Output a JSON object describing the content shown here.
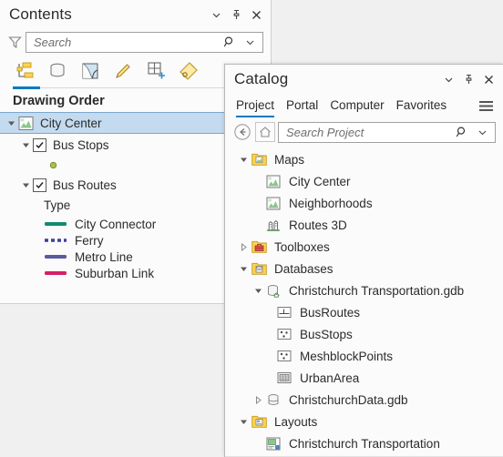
{
  "contents": {
    "title": "Contents",
    "titlebar_buttons": [
      {
        "name": "menu-chevron",
        "label": "⌄"
      },
      {
        "name": "pin",
        "label": "pin"
      },
      {
        "name": "close",
        "label": "×"
      }
    ],
    "filter_icon": "filter-icon",
    "search": {
      "placeholder": "Search",
      "value": ""
    },
    "toolbar": [
      {
        "name": "list-by-drawing-order",
        "label": "List By Drawing Order",
        "active": true
      },
      {
        "name": "list-by-data-source",
        "label": "List By Data Source",
        "active": false
      },
      {
        "name": "list-by-selection",
        "label": "List By Selection",
        "active": false
      },
      {
        "name": "list-by-editing",
        "label": "List By Editing",
        "active": false
      },
      {
        "name": "list-by-snapping",
        "label": "List By Snapping",
        "active": false
      },
      {
        "name": "list-by-labeling",
        "label": "List By Labeling",
        "active": false
      }
    ],
    "drawing_order_label": "Drawing Order",
    "tree": {
      "map": {
        "label": "City Center",
        "selected": true,
        "expanded": true
      },
      "layers": [
        {
          "label": "Bus Stops",
          "checked": true,
          "expanded": true,
          "symbol_type": "point",
          "point_color": "#8ea832",
          "legend": []
        },
        {
          "label": "Bus Routes",
          "checked": true,
          "expanded": true,
          "symbol_type": "line",
          "legend_heading": "Type",
          "legend": [
            {
              "label": "City Connector",
              "color": "#138a6a",
              "style": "solid"
            },
            {
              "label": "Ferry",
              "color": "#3c3f9e",
              "style": "dashed"
            },
            {
              "label": "Metro Line",
              "color": "#5a5a9e",
              "style": "solid"
            },
            {
              "label": "Suburban Link",
              "color": "#d61f69",
              "style": "solid"
            }
          ]
        }
      ]
    }
  },
  "catalog": {
    "title": "Catalog",
    "titlebar_buttons": [
      {
        "name": "menu-chevron",
        "label": "⌄"
      },
      {
        "name": "pin",
        "label": "pin"
      },
      {
        "name": "close",
        "label": "×"
      }
    ],
    "tabs": [
      {
        "label": "Project",
        "active": true
      },
      {
        "label": "Portal",
        "active": false
      },
      {
        "label": "Computer",
        "active": false
      },
      {
        "label": "Favorites",
        "active": false
      }
    ],
    "hamburger_label": "menu-icon",
    "nav": {
      "back_label": "back-icon",
      "home_label": "home-icon"
    },
    "search": {
      "placeholder": "Search Project",
      "value": ""
    },
    "tree": [
      {
        "label": "Maps",
        "indent": 0,
        "icon": "folder-maps-icon",
        "arrow": "expanded"
      },
      {
        "label": "City Center",
        "indent": 1,
        "icon": "map-icon",
        "arrow": "none"
      },
      {
        "label": "Neighborhoods",
        "indent": 1,
        "icon": "map-icon",
        "arrow": "none"
      },
      {
        "label": "Routes 3D",
        "indent": 1,
        "icon": "scene-3d-icon",
        "arrow": "none"
      },
      {
        "label": "Toolboxes",
        "indent": 0,
        "icon": "folder-toolbox-icon",
        "arrow": "collapsed"
      },
      {
        "label": "Databases",
        "indent": 0,
        "icon": "folder-databases-icon",
        "arrow": "expanded"
      },
      {
        "label": "Christchurch Transportation.gdb",
        "indent": 1,
        "icon": "gdb-home-icon",
        "arrow": "expanded"
      },
      {
        "label": "BusRoutes",
        "indent": 2,
        "icon": "line-feature-icon",
        "arrow": "none"
      },
      {
        "label": "BusStops",
        "indent": 2,
        "icon": "point-feature-icon",
        "arrow": "none"
      },
      {
        "label": "MeshblockPoints",
        "indent": 2,
        "icon": "point-feature-icon",
        "arrow": "none"
      },
      {
        "label": "UrbanArea",
        "indent": 2,
        "icon": "raster-icon",
        "arrow": "none"
      },
      {
        "label": "ChristchurchData.gdb",
        "indent": 1,
        "icon": "gdb-icon",
        "arrow": "collapsed"
      },
      {
        "label": "Layouts",
        "indent": 0,
        "icon": "folder-layouts-icon",
        "arrow": "expanded"
      },
      {
        "label": "Christchurch Transportation",
        "indent": 1,
        "icon": "layout-icon",
        "arrow": "none"
      }
    ]
  },
  "colors": {
    "accent": "#0079c1",
    "selection": "#c3daef",
    "panel_bg": "#fbfbfb",
    "text": "#2b2b2b"
  }
}
